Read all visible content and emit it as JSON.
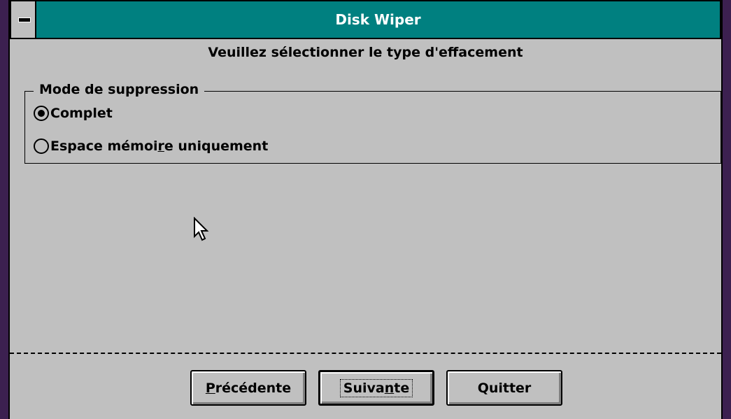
{
  "window": {
    "title": "Disk Wiper",
    "sysmenu_icon": "minus-icon"
  },
  "instruction": "Veuillez sélectionner le type d'effacement",
  "group": {
    "title": "Mode de suppression",
    "options": [
      {
        "pre": "",
        "mnemonic": "",
        "post": "Complet",
        "selected": true
      },
      {
        "pre": "Espace mémoi",
        "mnemonic": "r",
        "post": "e uniquement",
        "selected": false
      }
    ]
  },
  "buttons": {
    "previous": {
      "mnemonic": "P",
      "rest": "récédente"
    },
    "next": {
      "pre": "Suiva",
      "mnemonic": "n",
      "post": "te"
    },
    "quit": {
      "label": "Quitter"
    }
  },
  "colors": {
    "titlebar": "#008080",
    "face": "#c0c0c0"
  }
}
